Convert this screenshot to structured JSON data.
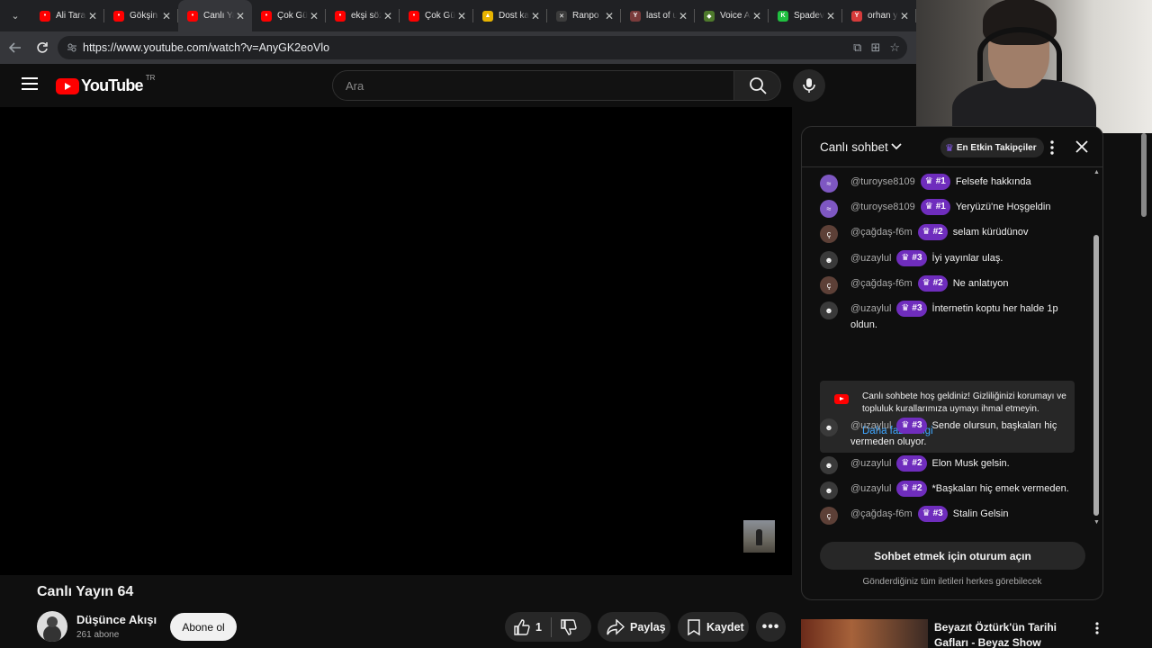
{
  "browser": {
    "tabs": [
      {
        "title": "Ali Tarar",
        "color": "#ff0000",
        "glyph": "•"
      },
      {
        "title": "Gökşin",
        "color": "#ff0000",
        "glyph": "•"
      },
      {
        "title": "Canlı Ya",
        "color": "#ff0000",
        "glyph": "•",
        "active": true
      },
      {
        "title": "Çok Gü",
        "color": "#ff0000",
        "glyph": "•"
      },
      {
        "title": "ekşi söz",
        "color": "#ff0000",
        "glyph": "•"
      },
      {
        "title": "Çok Gü",
        "color": "#ff0000",
        "glyph": "•"
      },
      {
        "title": "Dost ka",
        "color": "#e8b400",
        "glyph": "▲"
      },
      {
        "title": "Ranpo",
        "color": "#3c3c3c",
        "glyph": "✕"
      },
      {
        "title": "last of u",
        "color": "#7a3b3b",
        "glyph": "Y"
      },
      {
        "title": "Voice A",
        "color": "#4e7a2c",
        "glyph": "◆"
      },
      {
        "title": "Spadev",
        "color": "#20c040",
        "glyph": "K"
      },
      {
        "title": "orhan y",
        "color": "#d63b3b",
        "glyph": "Y"
      }
    ],
    "url": "https://www.youtube.com/watch?v=AnyGK2eoVlo"
  },
  "header": {
    "logo_text": "YouTube",
    "country": "TR",
    "search_placeholder": "Ara"
  },
  "video": {
    "title": "Canlı Yayın 64",
    "channel": "Düşünce Akışı",
    "subscribers": "261 abone",
    "subscribe_label": "Abone ol",
    "likes": "1",
    "share_label": "Paylaş",
    "save_label": "Kaydet"
  },
  "chat": {
    "title": "Canlı sohbet",
    "top_fans": "En Etkin Takipçiler",
    "messages": [
      {
        "user": "@turoyse8109",
        "badge": "#1",
        "text": "Felsefe hakkında",
        "av": "#7e57c2",
        "avg": "≈"
      },
      {
        "user": "@turoyse8109",
        "badge": "#1",
        "text": "Yeryüzü'ne Hoşgeldin",
        "av": "#7e57c2",
        "avg": "≈"
      },
      {
        "user": "@çağdaş-f6m",
        "badge": "#2",
        "text": "selam kürüdünov",
        "av": "#5d4037",
        "avg": "ç"
      },
      {
        "user": "@uzaylul",
        "badge": "#3",
        "text": "İyi yayınlar ulaş.",
        "av": "#3a3a3a",
        "avg": "☻"
      },
      {
        "user": "@çağdaş-f6m",
        "badge": "#2",
        "text": "Ne anlatıyon",
        "av": "#5d4037",
        "avg": "ç"
      },
      {
        "user": "@uzaylul",
        "badge": "#3",
        "text": "İnternetin koptu her halde 1p oldun.",
        "av": "#3a3a3a",
        "avg": "☻"
      },
      {
        "user": "@uzaylul",
        "badge": "#3",
        "text": "Sende olursun, başkaları hiç vermeden oluyor.",
        "av": "#3a3a3a",
        "avg": "☻"
      },
      {
        "user": "@uzaylul",
        "badge": "#2",
        "text": "Elon Musk gelsin.",
        "av": "#3a3a3a",
        "avg": "☻"
      },
      {
        "user": "@uzaylul",
        "badge": "#2",
        "text": "*Başkaları hiç emek vermeden.",
        "av": "#3a3a3a",
        "avg": "☻"
      },
      {
        "user": "@çağdaş-f6m",
        "badge": "#3",
        "text": "Stalin Gelsin",
        "av": "#5d4037",
        "avg": "ç"
      }
    ],
    "notice_text": "Canlı sohbete hoş geldiniz! Gizliliğinizi korumayı ve topluluk kurallarımıza uymayı ihmal etmeyin.",
    "notice_link": "Daha fazla bilgi",
    "signin_label": "Sohbet etmek için oturum açın",
    "footer": "Gönderdiğiniz tüm iletileri herkes görebilecek"
  },
  "related": {
    "title": "Beyazıt Öztürk'ün Tarihi Gafları - Beyaz Show"
  }
}
